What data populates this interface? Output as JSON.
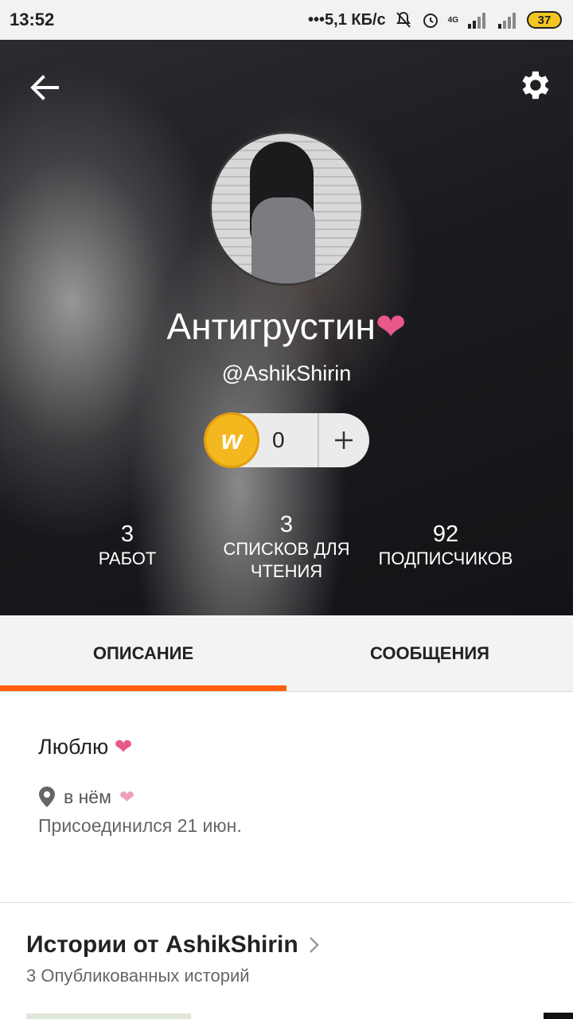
{
  "status_bar": {
    "time": "13:52",
    "network_speed": "5,1 КБ/с",
    "network_type": "4G",
    "battery": "37"
  },
  "header": {
    "back_icon": "arrow-left-icon",
    "settings_icon": "gear-icon"
  },
  "profile": {
    "display_name": "Антигрустин",
    "name_emoji": "❤",
    "username": "@AshikShirin",
    "coins": {
      "count": "0",
      "add_label": "+"
    },
    "stats": [
      {
        "value": "3",
        "label": "РАБОТ"
      },
      {
        "value": "3",
        "label": "СПИСКОВ ДЛЯ ЧТЕНИЯ"
      },
      {
        "value": "92",
        "label": "ПОДПИСЧИКОВ"
      }
    ]
  },
  "tabs": [
    {
      "label": "ОПИСАНИЕ",
      "active": true
    },
    {
      "label": "СООБЩЕНИЯ",
      "active": false
    }
  ],
  "about": {
    "bio": "Люблю",
    "bio_emoji": "❤",
    "location": "в нём",
    "location_emoji": "❤",
    "joined": "Присоединился 21 июн."
  },
  "stories": {
    "title": "Истории от AshikShirin",
    "subtitle": "3 Опубликованных историй"
  },
  "colors": {
    "accent": "#ff5d0a",
    "heart": "#e8588a",
    "coin": "#f4b81f"
  }
}
